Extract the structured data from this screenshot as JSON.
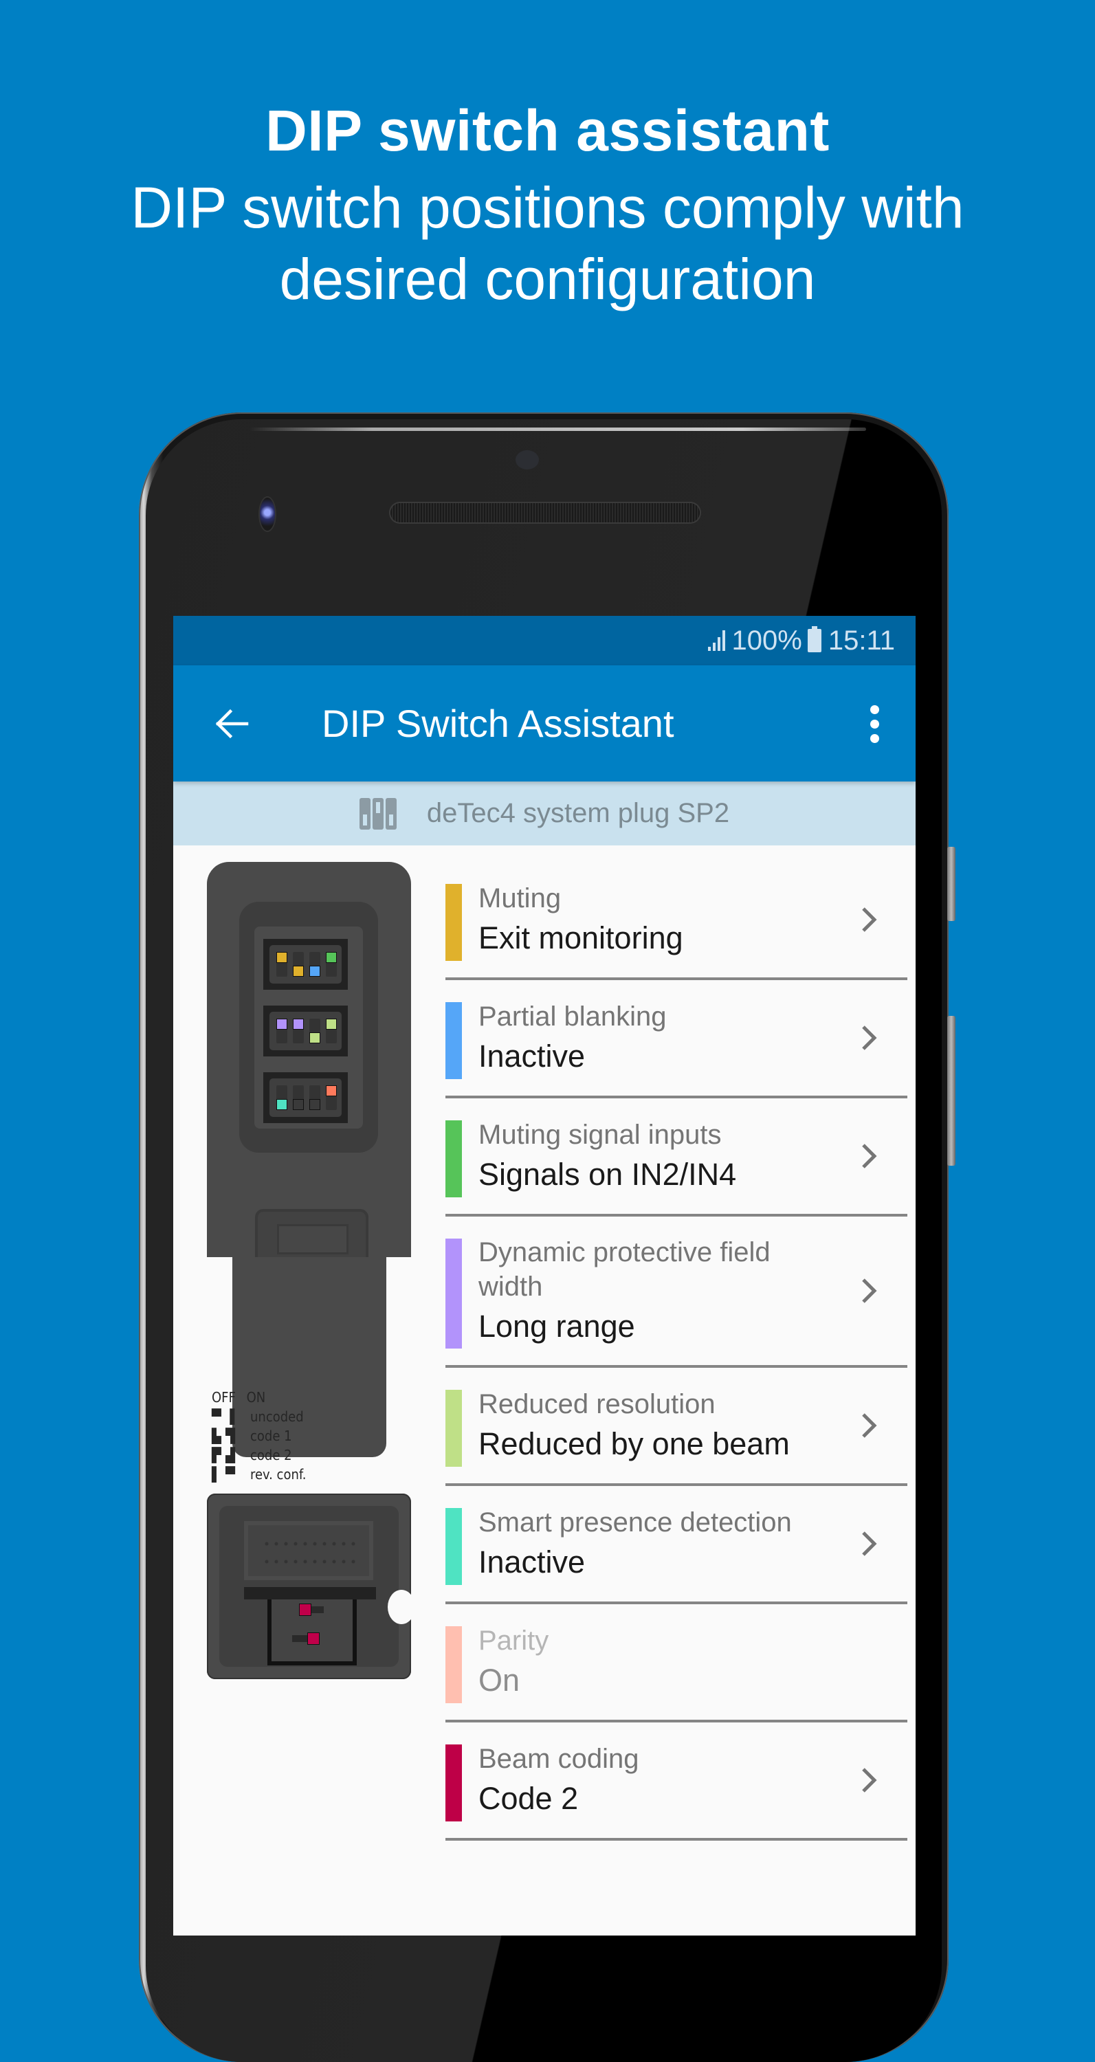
{
  "hero": {
    "title": "DIP switch assistant",
    "subtitle_line1": "DIP switch positions comply with",
    "subtitle_line2": "desired configuration"
  },
  "status_bar": {
    "signal_icon": "signal-icon",
    "battery_percent": "100%",
    "battery_icon": "battery-icon",
    "time": "15:11"
  },
  "app_bar": {
    "back_icon": "arrow-left-icon",
    "title": "DIP Switch Assistant",
    "menu_icon": "more-vert-icon"
  },
  "sub_header": {
    "icon": "dip-switch-icon",
    "label": "deTec4 system plug SP2"
  },
  "plug_legend": {
    "header_off": "OFF",
    "header_on": "ON",
    "rows": [
      {
        "label": "uncoded"
      },
      {
        "label": "code 1"
      },
      {
        "label": "code 2"
      },
      {
        "label": "rev. conf."
      }
    ]
  },
  "colors": {
    "background": "#0080c4",
    "status_bar": "#0065a0",
    "app_bar": "#0080c4",
    "sub_header": "#c9e1ee"
  },
  "settings": [
    {
      "label": "Muting",
      "value": "Exit monitoring",
      "color": "#e0b12c",
      "enabled": true
    },
    {
      "label": "Partial blanking",
      "value": "Inactive",
      "color": "#55a6f8",
      "enabled": true
    },
    {
      "label": "Muting signal inputs",
      "value": "Signals on IN2/IN4",
      "color": "#56c459",
      "enabled": true
    },
    {
      "label": "Dynamic protective field width",
      "value": "Long range",
      "color": "#b293fb",
      "enabled": true
    },
    {
      "label": "Reduced resolution",
      "value": "Reduced by one beam",
      "color": "#bfe087",
      "enabled": true
    },
    {
      "label": "Smart presence detection",
      "value": "Inactive",
      "color": "#4fe3c2",
      "enabled": true
    },
    {
      "label": "Parity",
      "value": "On",
      "color": "#ffbfb0",
      "enabled": false
    },
    {
      "label": "Beam coding",
      "value": "Code 2",
      "color": "#be0047",
      "enabled": true
    }
  ],
  "dip_switches": {
    "block1": [
      {
        "on": true,
        "color": "#e0b12c"
      },
      {
        "on": false,
        "color": "#e0b12c"
      },
      {
        "on": false,
        "color": "#55a6f8"
      },
      {
        "on": true,
        "color": "#56c459"
      }
    ],
    "block2": [
      {
        "on": true,
        "color": "#b293fb"
      },
      {
        "on": true,
        "color": "#b293fb"
      },
      {
        "on": false,
        "color": "#bfe087"
      },
      {
        "on": true,
        "color": "#bfe087"
      }
    ],
    "block3": [
      {
        "on": false,
        "color": "#4fe3c2"
      },
      {
        "on": false,
        "color": ""
      },
      {
        "on": false,
        "color": ""
      },
      {
        "on": true,
        "color": "#ff7a5c"
      }
    ],
    "beam_coding": [
      {
        "on": false,
        "color": "#c0004a"
      },
      {
        "on": true,
        "color": "#c0004a"
      }
    ]
  }
}
